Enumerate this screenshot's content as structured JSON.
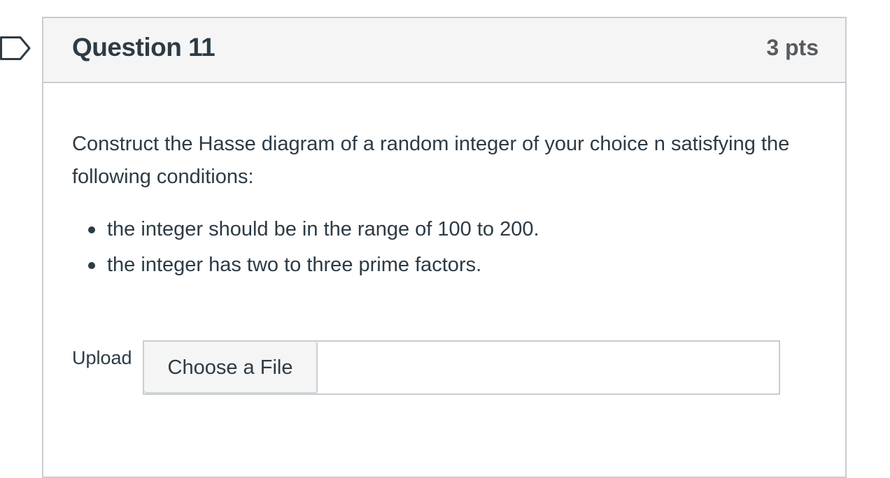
{
  "question": {
    "title": "Question 11",
    "points": "3 pts",
    "prompt": "Construct the Hasse diagram of a random integer of your choice n satisfying the following conditions:",
    "conditions": [
      "the integer should be in the range of 100 to 200.",
      "the integer has two to three prime factors."
    ]
  },
  "upload": {
    "label": "Upload",
    "button_label": "Choose a File"
  },
  "icons": {
    "flag": "flag-question-icon"
  },
  "colors": {
    "text": "#2d3b45",
    "points": "#565b5f",
    "border": "#c7cdd1",
    "header_bg": "#f5f5f5"
  }
}
